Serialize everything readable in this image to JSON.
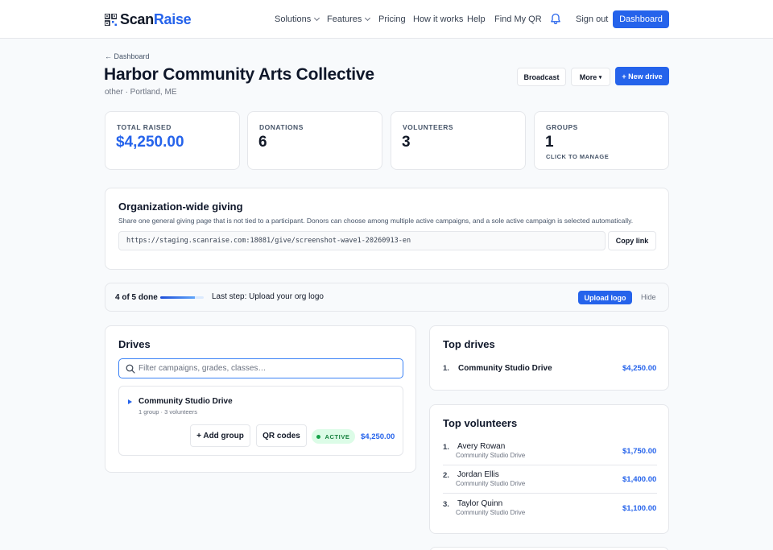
{
  "nav": {
    "brand_part1": "Scan",
    "brand_part2": "Raise",
    "links": [
      "Solutions",
      "Features",
      "Pricing",
      "How it works",
      "Help",
      "Find My QR"
    ],
    "sign_out": "Sign out",
    "dashboard": "Dashboard"
  },
  "header": {
    "back": "← Dashboard",
    "title": "Harbor Community Arts Collective",
    "subtitle": "other · Portland, ME",
    "broadcast": "Broadcast",
    "more": "More",
    "more_caret": "▾",
    "new_drive": "+ New drive"
  },
  "stats": [
    {
      "label": "TOTAL RAISED",
      "value": "$4,250.00"
    },
    {
      "label": "DONATIONS",
      "value": "6"
    },
    {
      "label": "VOLUNTEERS",
      "value": "3"
    },
    {
      "label": "GROUPS",
      "value": "1",
      "sub": "CLICK TO MANAGE"
    }
  ],
  "giving": {
    "title": "Organization-wide giving",
    "description": "Share one general giving page that is not tied to a participant. Donors can choose among multiple active campaigns, and a sole active campaign is selected automatically.",
    "url": "https://staging.scanraise.com:18081/give/screenshot-wave1-20260913-en",
    "copy": "Copy link"
  },
  "progress": {
    "label": "4 of 5 done",
    "fraction": 0.8,
    "step": "Last step: Upload your org logo",
    "upload": "Upload logo",
    "hide": "Hide"
  },
  "drives": {
    "title": "Drives",
    "placeholder": "Filter campaigns, grades, classes…",
    "items": [
      {
        "name": "Community Studio Drive",
        "meta": "1 group · 3 volunteers",
        "add_group": "+ Add group",
        "qr": "QR codes",
        "status": "ACTIVE",
        "amount": "$4,250.00"
      }
    ]
  },
  "top_drives": {
    "title": "Top drives",
    "items": [
      {
        "rank": "1.",
        "name": "Community Studio Drive",
        "amount": "$4,250.00"
      }
    ]
  },
  "top_volunteers": {
    "title": "Top volunteers",
    "items": [
      {
        "rank": "1.",
        "name": "Avery Rowan",
        "drive": "Community Studio Drive",
        "amount": "$1,750.00"
      },
      {
        "rank": "2.",
        "name": "Jordan Ellis",
        "drive": "Community Studio Drive",
        "amount": "$1,400.00"
      },
      {
        "rank": "3.",
        "name": "Taylor Quinn",
        "drive": "Community Studio Drive",
        "amount": "$1,100.00"
      }
    ]
  },
  "colors": {
    "accent": "#2563eb",
    "active_bg": "#dcfce7",
    "active_text": "#15803d"
  }
}
